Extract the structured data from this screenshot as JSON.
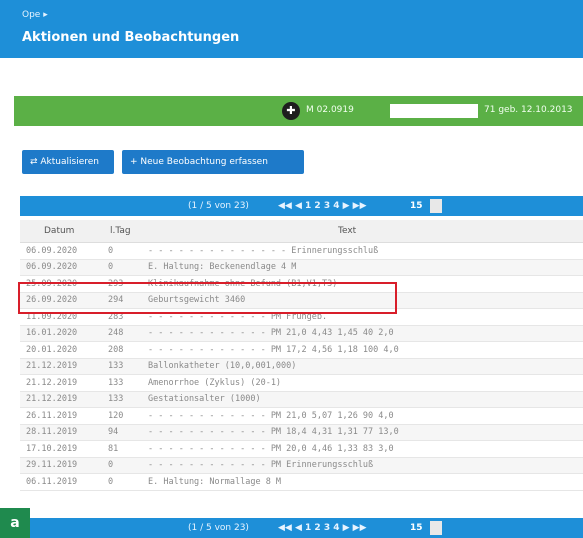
{
  "header": {
    "sup": "Ope ▸",
    "title": "Aktionen und Beobachtungen"
  },
  "patient_bar": {
    "icon": "patient-circle-icon",
    "info": "M 02.0919",
    "info_right": "71 geb. 12.10.2013"
  },
  "buttons": {
    "aktualisieren": "⇄ Aktualisieren",
    "neu": "+ Neue Beobachtung erfassen"
  },
  "pager": {
    "text": "(1 / 5 von 23)",
    "numbers": "◀◀ ◀ 1 2 3 4 ▶ ▶▶",
    "count": "15"
  },
  "table": {
    "headers": [
      "Datum",
      "l.Tag",
      "Text"
    ],
    "rows": [
      [
        "06.09.2020",
        "0",
        "- - - - - - - - - - - - - -   Erinnerungsschluß"
      ],
      [
        "06.09.2020",
        "0",
        "E. Haltung: Beckenendlage 4 M"
      ],
      [
        "25.09.2020",
        "293",
        "Klinikaufnahme ohne Befund (B1,V1,T3)"
      ],
      [
        "26.09.2020",
        "294",
        "Geburtsgewicht 3460"
      ],
      [
        "11.09.2020",
        "283",
        "- - - - - - - - - - - - PM    Frühgeb."
      ],
      [
        "16.01.2020",
        "248",
        "- - - - - - - - - - - - PM    21,0 4,43 1,45  40  2,0"
      ],
      [
        "20.01.2020",
        "208",
        "- - - - - - - - - - - - PM    17,2 4,56 1,18  100  4,0"
      ],
      [
        "21.12.2019",
        "133",
        "Ballonkatheter (10,0,001,000)"
      ],
      [
        "21.12.2019",
        "133",
        "Amenorrhoe (Zyklus) (20-1)"
      ],
      [
        "21.12.2019",
        "133",
        "Gestationsalter (1000)"
      ],
      [
        "26.11.2019",
        "120",
        "- - - - - - - - - - - - PM    21,0 5,07 1,26  90  4,0"
      ],
      [
        "28.11.2019",
        "94",
        "- - - - - - - - - - - - PM    18,4 4,31 1,31  77  13,0"
      ],
      [
        "17.10.2019",
        "81",
        "- - - - - - - - - - - - PM    20,0 4,46 1,33  83  3,0"
      ],
      [
        "29.11.2019",
        "0",
        "- - - - - - - - - - - - PM    Erinnerungsschluß"
      ],
      [
        "06.11.2019",
        "0",
        "E. Haltung: Normallage 8 M"
      ]
    ]
  },
  "figure_label": "a",
  "colors": {
    "header": "#1e8fd8",
    "patient_bar": "#5bb046",
    "button": "#1e7ac9",
    "highlight": "#d81e2a",
    "label": "#1f8a4e"
  }
}
